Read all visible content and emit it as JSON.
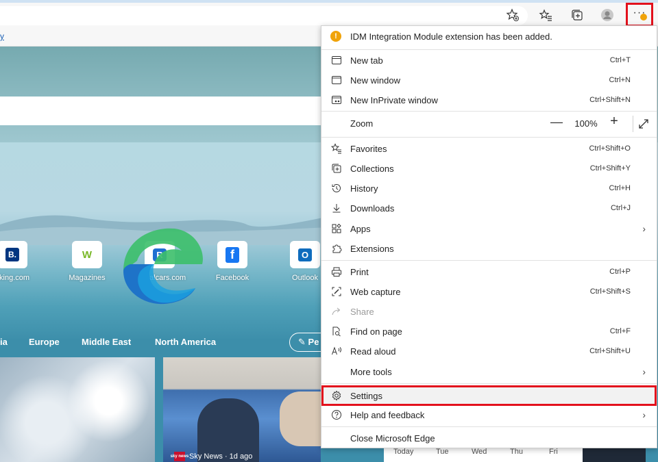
{
  "browser": {
    "favbar_link": "y",
    "toolbar_icons": [
      "add-favorite-icon",
      "favorites-icon",
      "collections-icon",
      "profile-icon"
    ],
    "menu_button": "···",
    "accent_red": "#e3101c",
    "badge_color": "#f0a30a"
  },
  "page": {
    "tiles": [
      {
        "icon": "booking-logo",
        "glyph": "B.",
        "label": "oking.com",
        "color": "#003580"
      },
      {
        "icon": "magazines-logo",
        "glyph": "W",
        "label": "Magazines",
        "color": "#7ab829"
      },
      {
        "icon": "rentalcars-logo",
        "glyph": "R",
        "label": "Rentalcars.com",
        "color": "#1f6fd1"
      },
      {
        "icon": "facebook-logo",
        "glyph": "f",
        "label": "Facebook",
        "color": "#1877f2"
      },
      {
        "icon": "outlook-logo",
        "glyph": "O",
        "label": "Outlook",
        "color": "#0f6cbd"
      }
    ],
    "nav": [
      "ia",
      "Europe",
      "Middle East",
      "North America"
    ],
    "personalize_label": "Pe",
    "news_source": "Sky News · 1d ago",
    "news_source_logo": "sky news",
    "calendar_days": [
      "Today",
      "Tue",
      "Wed",
      "Thu",
      "Fri"
    ]
  },
  "menu": {
    "notification": "IDM Integration Module extension has been added.",
    "notification_icon": "!",
    "group1": [
      {
        "label": "New tab",
        "shortcut": "Ctrl+T",
        "icon": "new-tab-icon"
      },
      {
        "label": "New window",
        "shortcut": "Ctrl+N",
        "icon": "new-window-icon"
      },
      {
        "label": "New InPrivate window",
        "shortcut": "Ctrl+Shift+N",
        "icon": "inprivate-icon"
      }
    ],
    "zoom": {
      "label": "Zoom",
      "value": "100%",
      "minus": "—",
      "plus": "+"
    },
    "group2": [
      {
        "label": "Favorites",
        "shortcut": "Ctrl+Shift+O",
        "icon": "favorites-icon"
      },
      {
        "label": "Collections",
        "shortcut": "Ctrl+Shift+Y",
        "icon": "collections-icon"
      },
      {
        "label": "History",
        "shortcut": "Ctrl+H",
        "icon": "history-icon"
      },
      {
        "label": "Downloads",
        "shortcut": "Ctrl+J",
        "icon": "downloads-icon"
      },
      {
        "label": "Apps",
        "shortcut": "",
        "icon": "apps-icon",
        "chevron": "›"
      },
      {
        "label": "Extensions",
        "shortcut": "",
        "icon": "extensions-icon"
      }
    ],
    "group3": [
      {
        "label": "Print",
        "shortcut": "Ctrl+P",
        "icon": "print-icon"
      },
      {
        "label": "Web capture",
        "shortcut": "Ctrl+Shift+S",
        "icon": "web-capture-icon"
      },
      {
        "label": "Share",
        "shortcut": "",
        "icon": "share-icon",
        "disabled": true
      },
      {
        "label": "Find on page",
        "shortcut": "Ctrl+F",
        "icon": "find-icon"
      },
      {
        "label": "Read aloud",
        "shortcut": "Ctrl+Shift+U",
        "icon": "read-aloud-icon"
      },
      {
        "label": "More tools",
        "shortcut": "",
        "icon": "",
        "chevron": "›"
      }
    ],
    "group4": [
      {
        "label": "Settings",
        "shortcut": "",
        "icon": "settings-icon"
      },
      {
        "label": "Help and feedback",
        "shortcut": "",
        "icon": "help-icon",
        "chevron": "›"
      }
    ],
    "close": {
      "label": "Close Microsoft Edge"
    }
  }
}
